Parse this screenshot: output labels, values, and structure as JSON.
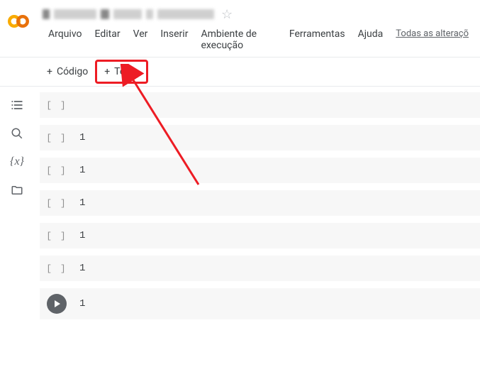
{
  "header": {
    "notebook_title": "████████ ████ ████████"
  },
  "menu": {
    "arquivo": "Arquivo",
    "editar": "Editar",
    "ver": "Ver",
    "inserir": "Inserir",
    "ambiente": "Ambiente de execução",
    "ferramentas": "Ferramentas",
    "ajuda": "Ajuda",
    "save_status": "Todas as alteraçõ"
  },
  "toolbar": {
    "code_label": "Código",
    "text_label": "Texto"
  },
  "cells": [
    {
      "prompt": "[ ]",
      "content": ""
    },
    {
      "prompt": "[ ]",
      "content": "1"
    },
    {
      "prompt": "[ ]",
      "content": "1"
    },
    {
      "prompt": "[ ]",
      "content": "1"
    },
    {
      "prompt": "[ ]",
      "content": "1"
    },
    {
      "prompt": "[ ]",
      "content": "1"
    },
    {
      "prompt": "play",
      "content": "1"
    }
  ]
}
